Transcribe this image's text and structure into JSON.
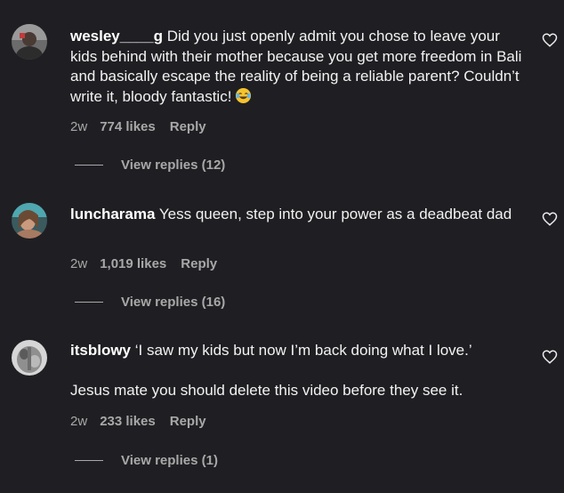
{
  "comments": [
    {
      "username": "wesley____g",
      "text": "Did you just openly admit you chose to leave your kids behind with their mother because you get more freedom in Bali and basically escape the reality of being a reliable parent? Couldn’t write it, bloody fantastic!",
      "emoji_icon": "face-with-tears-of-joy-emoji",
      "time": "2w",
      "likes": "774 likes",
      "reply": "Reply",
      "view_replies": "View replies (12)"
    },
    {
      "username": "luncharama",
      "text": "Yess queen, step into your power as a deadbeat dad",
      "time": "2w",
      "likes": "1,019 likes",
      "reply": "Reply",
      "view_replies": "View replies (16)"
    },
    {
      "username": "itsblowy",
      "text": "‘I saw my kids but now I’m back doing what I love.’",
      "text_2": "Jesus mate you should delete this video before they see it.",
      "time": "2w",
      "likes": "233 likes",
      "reply": "Reply",
      "view_replies": "View replies (1)"
    }
  ],
  "colors": {
    "background": "#1f1f23",
    "text": "#f2f2f2",
    "secondary_text": "#a8a8a8"
  }
}
